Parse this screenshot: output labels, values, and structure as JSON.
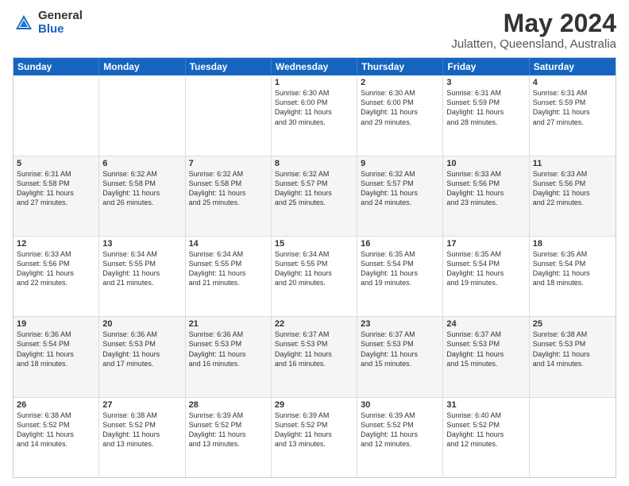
{
  "logo": {
    "general": "General",
    "blue": "Blue"
  },
  "title": "May 2024",
  "subtitle": "Julatten, Queensland, Australia",
  "days": [
    "Sunday",
    "Monday",
    "Tuesday",
    "Wednesday",
    "Thursday",
    "Friday",
    "Saturday"
  ],
  "weeks": [
    [
      {
        "day": "",
        "info": ""
      },
      {
        "day": "",
        "info": ""
      },
      {
        "day": "",
        "info": ""
      },
      {
        "day": "1",
        "info": "Sunrise: 6:30 AM\nSunset: 6:00 PM\nDaylight: 11 hours\nand 30 minutes."
      },
      {
        "day": "2",
        "info": "Sunrise: 6:30 AM\nSunset: 6:00 PM\nDaylight: 11 hours\nand 29 minutes."
      },
      {
        "day": "3",
        "info": "Sunrise: 6:31 AM\nSunset: 5:59 PM\nDaylight: 11 hours\nand 28 minutes."
      },
      {
        "day": "4",
        "info": "Sunrise: 6:31 AM\nSunset: 5:59 PM\nDaylight: 11 hours\nand 27 minutes."
      }
    ],
    [
      {
        "day": "5",
        "info": "Sunrise: 6:31 AM\nSunset: 5:58 PM\nDaylight: 11 hours\nand 27 minutes."
      },
      {
        "day": "6",
        "info": "Sunrise: 6:32 AM\nSunset: 5:58 PM\nDaylight: 11 hours\nand 26 minutes."
      },
      {
        "day": "7",
        "info": "Sunrise: 6:32 AM\nSunset: 5:58 PM\nDaylight: 11 hours\nand 25 minutes."
      },
      {
        "day": "8",
        "info": "Sunrise: 6:32 AM\nSunset: 5:57 PM\nDaylight: 11 hours\nand 25 minutes."
      },
      {
        "day": "9",
        "info": "Sunrise: 6:32 AM\nSunset: 5:57 PM\nDaylight: 11 hours\nand 24 minutes."
      },
      {
        "day": "10",
        "info": "Sunrise: 6:33 AM\nSunset: 5:56 PM\nDaylight: 11 hours\nand 23 minutes."
      },
      {
        "day": "11",
        "info": "Sunrise: 6:33 AM\nSunset: 5:56 PM\nDaylight: 11 hours\nand 22 minutes."
      }
    ],
    [
      {
        "day": "12",
        "info": "Sunrise: 6:33 AM\nSunset: 5:56 PM\nDaylight: 11 hours\nand 22 minutes."
      },
      {
        "day": "13",
        "info": "Sunrise: 6:34 AM\nSunset: 5:55 PM\nDaylight: 11 hours\nand 21 minutes."
      },
      {
        "day": "14",
        "info": "Sunrise: 6:34 AM\nSunset: 5:55 PM\nDaylight: 11 hours\nand 21 minutes."
      },
      {
        "day": "15",
        "info": "Sunrise: 6:34 AM\nSunset: 5:55 PM\nDaylight: 11 hours\nand 20 minutes."
      },
      {
        "day": "16",
        "info": "Sunrise: 6:35 AM\nSunset: 5:54 PM\nDaylight: 11 hours\nand 19 minutes."
      },
      {
        "day": "17",
        "info": "Sunrise: 6:35 AM\nSunset: 5:54 PM\nDaylight: 11 hours\nand 19 minutes."
      },
      {
        "day": "18",
        "info": "Sunrise: 6:35 AM\nSunset: 5:54 PM\nDaylight: 11 hours\nand 18 minutes."
      }
    ],
    [
      {
        "day": "19",
        "info": "Sunrise: 6:36 AM\nSunset: 5:54 PM\nDaylight: 11 hours\nand 18 minutes."
      },
      {
        "day": "20",
        "info": "Sunrise: 6:36 AM\nSunset: 5:53 PM\nDaylight: 11 hours\nand 17 minutes."
      },
      {
        "day": "21",
        "info": "Sunrise: 6:36 AM\nSunset: 5:53 PM\nDaylight: 11 hours\nand 16 minutes."
      },
      {
        "day": "22",
        "info": "Sunrise: 6:37 AM\nSunset: 5:53 PM\nDaylight: 11 hours\nand 16 minutes."
      },
      {
        "day": "23",
        "info": "Sunrise: 6:37 AM\nSunset: 5:53 PM\nDaylight: 11 hours\nand 15 minutes."
      },
      {
        "day": "24",
        "info": "Sunrise: 6:37 AM\nSunset: 5:53 PM\nDaylight: 11 hours\nand 15 minutes."
      },
      {
        "day": "25",
        "info": "Sunrise: 6:38 AM\nSunset: 5:53 PM\nDaylight: 11 hours\nand 14 minutes."
      }
    ],
    [
      {
        "day": "26",
        "info": "Sunrise: 6:38 AM\nSunset: 5:52 PM\nDaylight: 11 hours\nand 14 minutes."
      },
      {
        "day": "27",
        "info": "Sunrise: 6:38 AM\nSunset: 5:52 PM\nDaylight: 11 hours\nand 13 minutes."
      },
      {
        "day": "28",
        "info": "Sunrise: 6:39 AM\nSunset: 5:52 PM\nDaylight: 11 hours\nand 13 minutes."
      },
      {
        "day": "29",
        "info": "Sunrise: 6:39 AM\nSunset: 5:52 PM\nDaylight: 11 hours\nand 13 minutes."
      },
      {
        "day": "30",
        "info": "Sunrise: 6:39 AM\nSunset: 5:52 PM\nDaylight: 11 hours\nand 12 minutes."
      },
      {
        "day": "31",
        "info": "Sunrise: 6:40 AM\nSunset: 5:52 PM\nDaylight: 11 hours\nand 12 minutes."
      },
      {
        "day": "",
        "info": ""
      }
    ]
  ]
}
